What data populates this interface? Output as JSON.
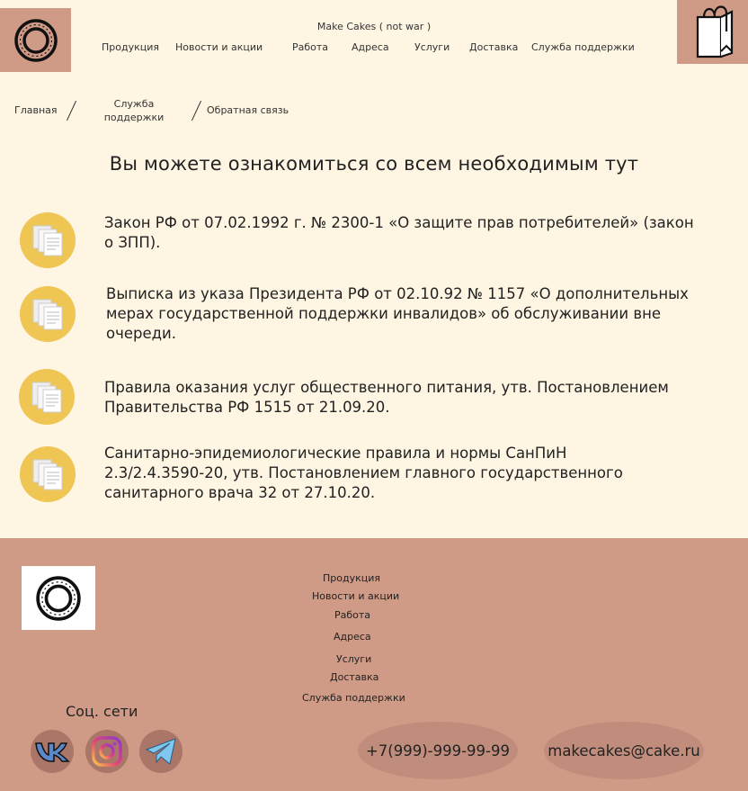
{
  "header": {
    "site_title": "Make Cakes ( not war )",
    "nav": [
      "Продукция",
      "Новости и акции",
      "Работа",
      "Адреса",
      "Услуги",
      "Доставка",
      "Служба поддержки"
    ]
  },
  "breadcrumb": {
    "home": "Главная",
    "support_line1": "Служба",
    "support_line2": "поддержки",
    "current": "Обратная связь"
  },
  "main": {
    "heading": "Вы можете ознакомиться со всем необходимым тут",
    "documents": [
      {
        "lines": [
          "Закон РФ от 07.02.1992 г. № 2300-1 «О защите прав потребителей» (закон",
          "о ЗПП)."
        ]
      },
      {
        "lines": [
          "Выписка из указа Президента РФ от 02.10.92 № 1157 «О дополнительных",
          "мерах государственной поддержки инвалидов» об обслуживании вне",
          "очереди."
        ]
      },
      {
        "lines": [
          "Правила оказания услуг общественного питания, утв. Постановлением",
          "Правительства РФ 1515 от 21.09.20."
        ]
      },
      {
        "lines": [
          "Санитарно-эпидемиологические правила и нормы СанПиН",
          "2.3/2.4.3590-20, утв. Постановлением главного государственного",
          "санитарного врача 32 от 27.10.20."
        ]
      }
    ]
  },
  "footer": {
    "nav": [
      "Продукция",
      "Новости и акции",
      "Работа",
      "Адреса",
      "Услуги",
      "Доставка",
      "Служба поддержки"
    ],
    "social_title": "Соц. сети",
    "phone": "+7(999)-999-99-99",
    "email": "makecakes@cake.ru"
  },
  "colors": {
    "background": "#fef5e3",
    "accent": "#cf9a86",
    "doc_icon": "#efc654"
  },
  "icons": [
    "logo-icon",
    "shopping-bag-icon",
    "document-icon",
    "vk-icon",
    "instagram-icon",
    "telegram-icon"
  ]
}
